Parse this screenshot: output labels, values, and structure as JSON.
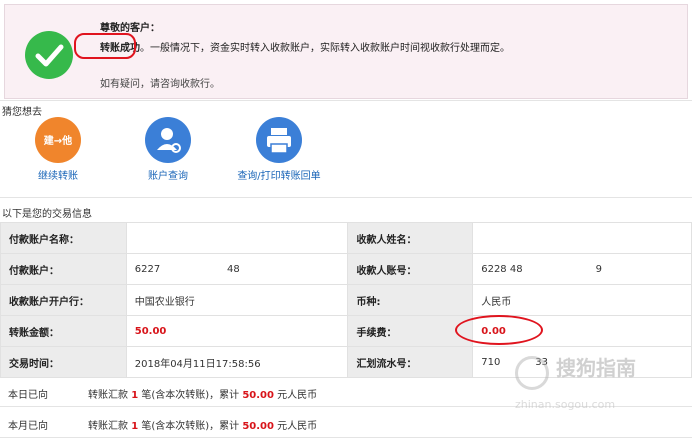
{
  "notice": {
    "greeting": "尊敬的客户：",
    "success_text": "转账成功",
    "message_rest": "。一般情况下，资金实时转入收款账户，实际转入收款账户时间视收款行处理而定。",
    "inquiry": "如有疑问，请咨询收款行。"
  },
  "guess": {
    "title": "猜您想去",
    "items": [
      {
        "label": "继续转账",
        "icon_text": "建→他",
        "icon": "transfer-icon"
      },
      {
        "label": "账户查询",
        "icon": "account-query-icon"
      },
      {
        "label": "查询/打印转账回单",
        "icon": "printer-icon"
      }
    ]
  },
  "info": {
    "title": "以下是您的交易信息",
    "rows": [
      {
        "l1": "付款账户名称：",
        "v1": "",
        "l2": "收款人姓名：",
        "v2": ""
      },
      {
        "l1": "付款账户：",
        "v1": "6227                     48",
        "l2": "收款人账号：",
        "v2": "6228 48                       9"
      },
      {
        "l1": "收款账户开户行：",
        "v1": "中国农业银行",
        "l2": "币种:",
        "v2": "人民币"
      },
      {
        "l1": "转账金额：",
        "v1": "50.00",
        "l2": "手续费：",
        "v2": "0.00"
      },
      {
        "l1": "交易时间：",
        "v1": "2018年04月11日17:58:56",
        "l2": "汇划流水号：",
        "v2": "710           33"
      }
    ]
  },
  "summary": [
    {
      "label": "本日已向",
      "pre": "转账汇款",
      "count": "1",
      "mid": "笔(含本次转账)，累计",
      "amount": "50.00",
      "post": "元人民币"
    },
    {
      "label": "本月已向",
      "pre": "转账汇款",
      "count": "1",
      "mid": "笔(含本次转账)，累计",
      "amount": "50.00",
      "post": "元人民币"
    }
  ],
  "watermark": {
    "brand": "搜狗指南",
    "url": "zhinan.sogou.com"
  },
  "colors": {
    "success_green": "#36b94b",
    "accent_red": "#d8141a",
    "link_blue": "#1b66b8"
  }
}
